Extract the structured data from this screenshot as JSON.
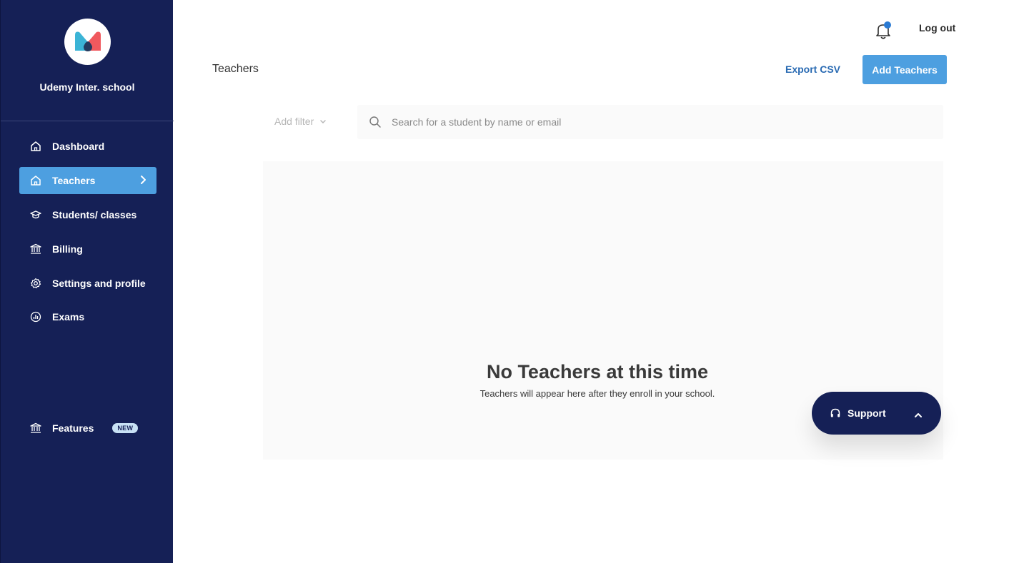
{
  "sidebar": {
    "school_name": "Udemy Inter. school",
    "items": [
      {
        "label": "Dashboard",
        "icon": "home-icon"
      },
      {
        "label": "Teachers",
        "icon": "home-icon",
        "active": true
      },
      {
        "label": "Students/ classes",
        "icon": "graduation-cap-icon"
      },
      {
        "label": "Billing",
        "icon": "bank-icon"
      },
      {
        "label": "Settings and profile",
        "icon": "gear-icon"
      },
      {
        "label": "Exams",
        "icon": "chart-icon"
      }
    ],
    "features": {
      "label": "Features",
      "badge": "NEW",
      "icon": "bank-icon"
    }
  },
  "header": {
    "logout_label": "Log out",
    "notification_icon": "bell-icon"
  },
  "main": {
    "title": "Teachers",
    "export_label": "Export CSV",
    "add_label": "Add Teachers",
    "filter_label": "Add filter",
    "search_placeholder": "Search for a student by name or email",
    "empty_title": "No Teachers at this time",
    "empty_subtitle": "Teachers will appear here after they enroll in your school."
  },
  "support": {
    "label": "Support"
  },
  "colors": {
    "sidebar_bg": "#152056",
    "accent": "#4d9fe0",
    "link": "#2a6bb3",
    "notification_dot": "#2a7ad3"
  }
}
